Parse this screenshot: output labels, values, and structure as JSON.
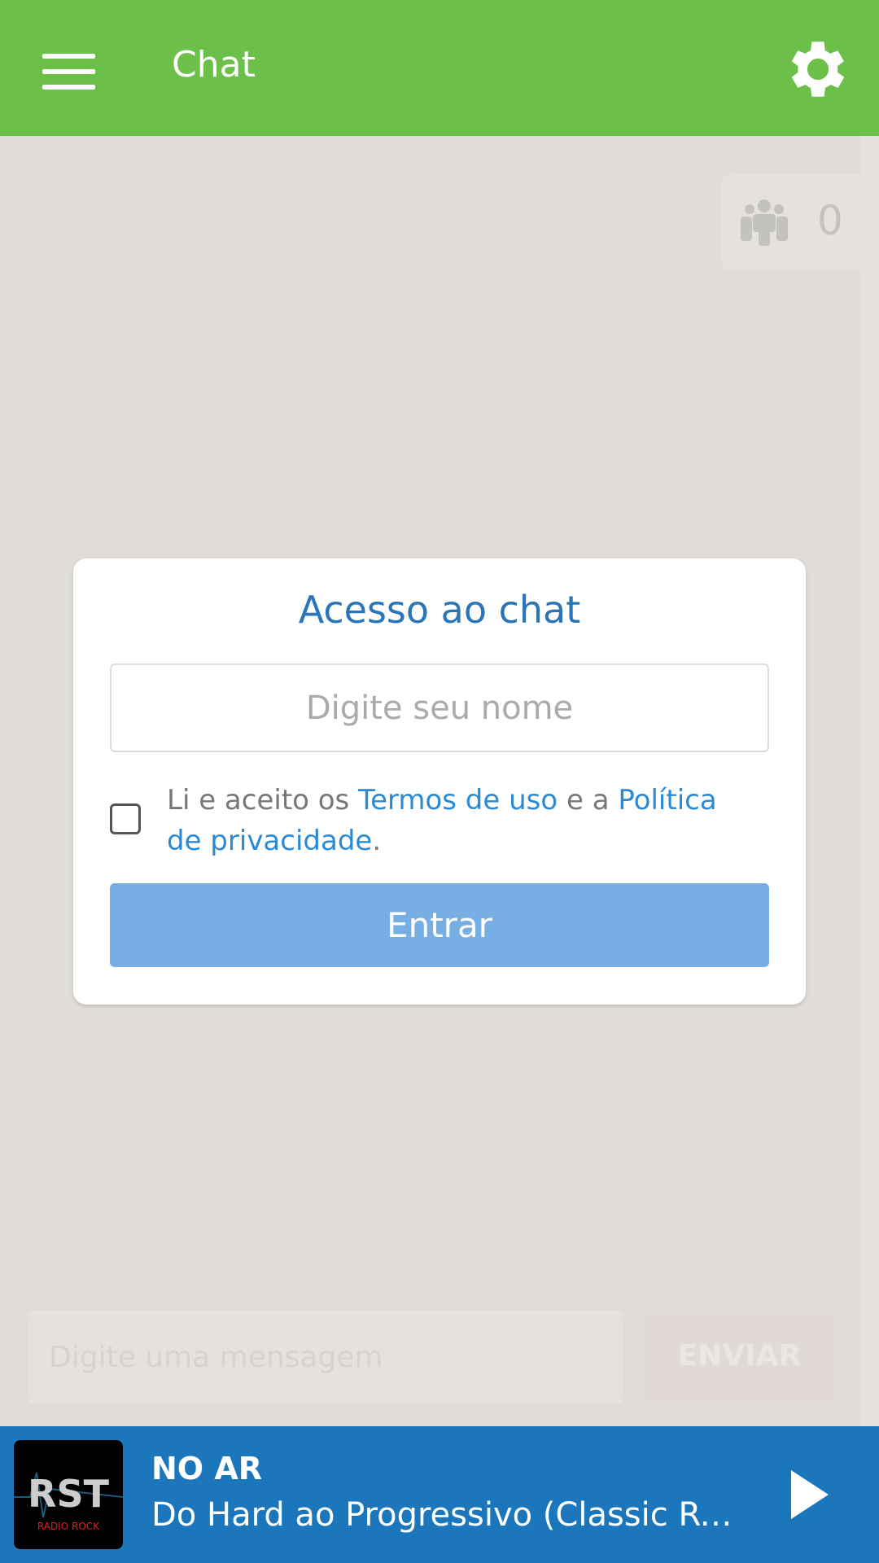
{
  "header": {
    "title": "Chat",
    "menu_icon": "hamburger-icon",
    "settings_icon": "gear-icon",
    "color": "#6cc04a"
  },
  "users": {
    "icon": "users-group-icon",
    "count": "0"
  },
  "login": {
    "title": "Acesso ao chat",
    "name_placeholder": "Digite seu nome",
    "name_value": "",
    "checked": false,
    "terms_prefix": "Li e aceito os ",
    "terms_link": "Termos de uso",
    "terms_middle": " e a ",
    "privacy_link": "Política de privacidade",
    "terms_suffix": ".",
    "enter_label": "Entrar"
  },
  "composer": {
    "placeholder": "Digite uma mensagem",
    "send_label": "ENVIAR"
  },
  "player": {
    "logo_text": "RST",
    "logo_sub": "RADIO ROCK",
    "status": "NO AR",
    "track": "Do Hard ao Progressivo (Classic Rock)",
    "play_icon": "play-icon",
    "color": "#1c76bb"
  }
}
